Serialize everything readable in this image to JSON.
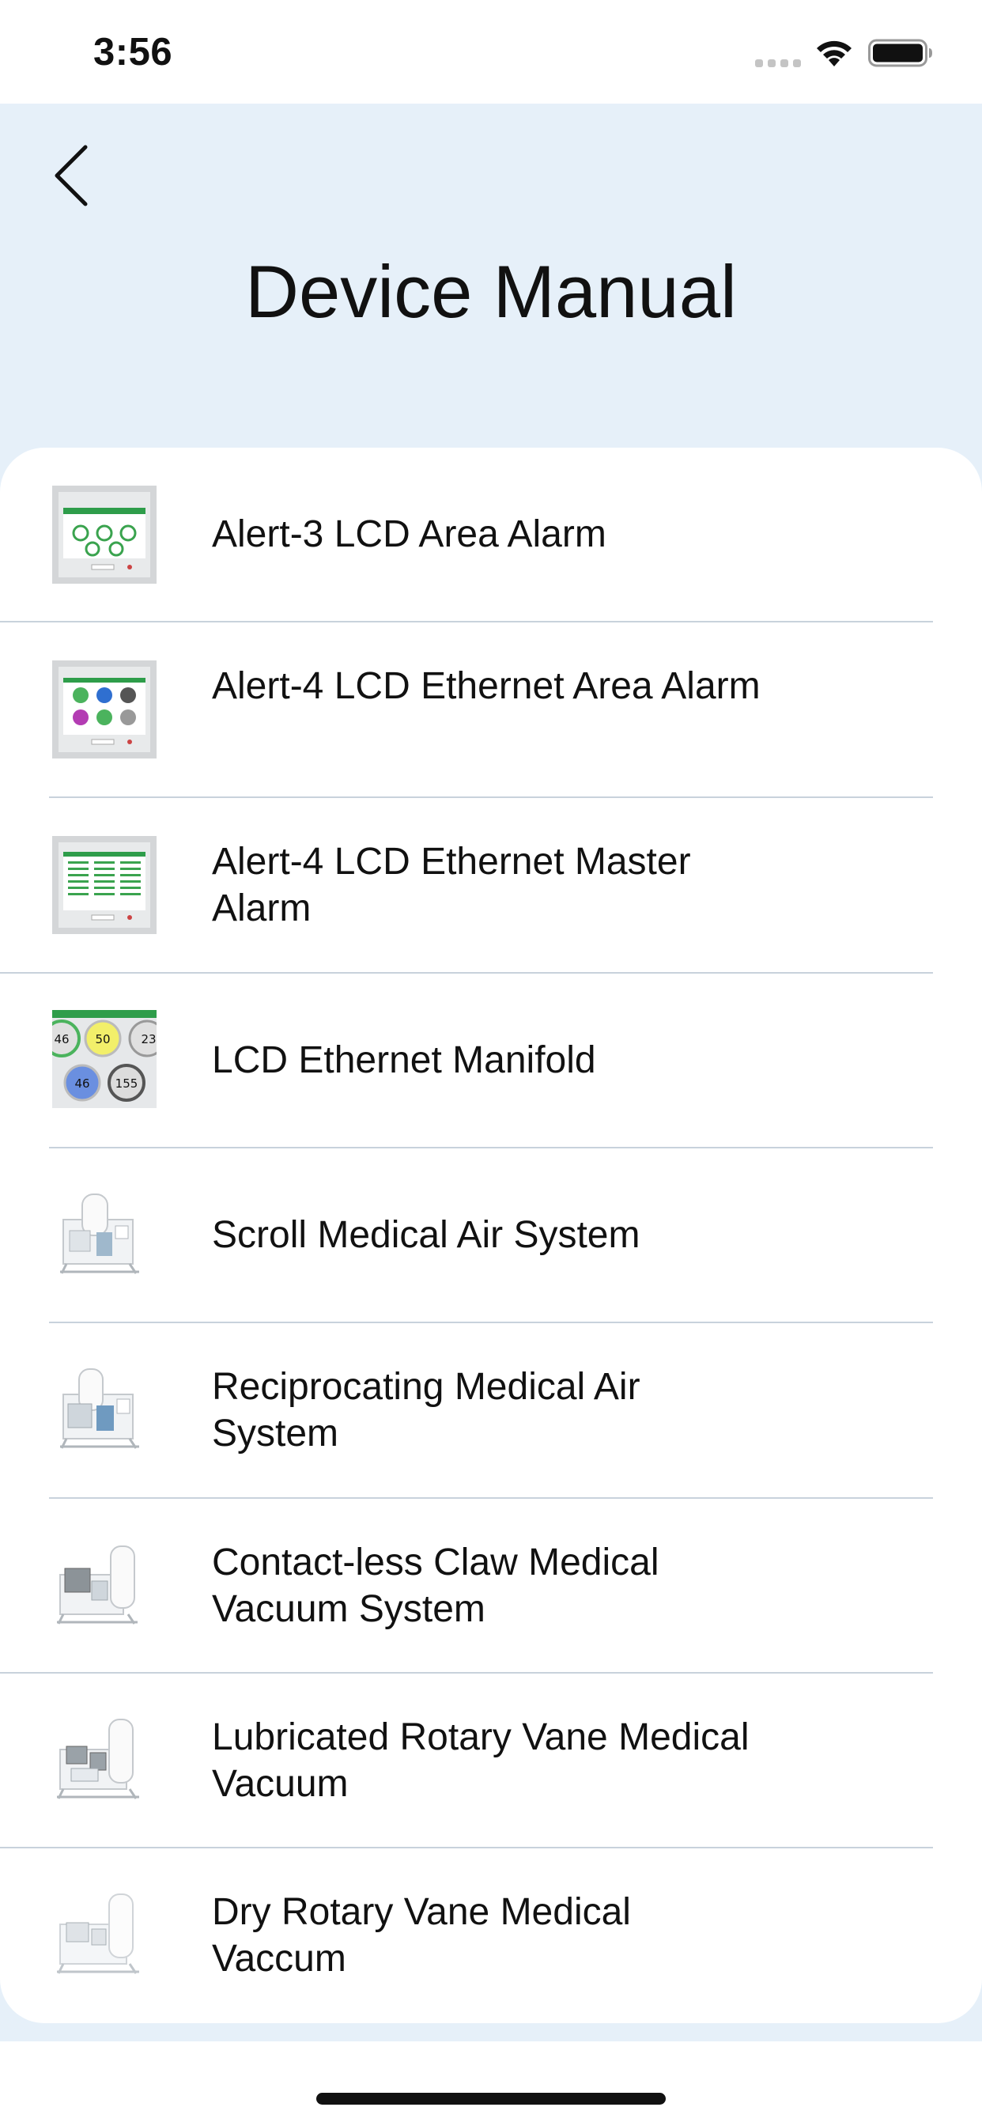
{
  "status_bar": {
    "time": "3:56"
  },
  "header": {
    "title": "Device Manual",
    "back_icon": "chevron-left-icon"
  },
  "items": [
    {
      "label": "Alert-3 LCD Area Alarm",
      "icon": "alarm-panel-thumbnail"
    },
    {
      "label": "Alert-4 LCD Ethernet Area Alarm",
      "icon": "alarm-panel-thumbnail"
    },
    {
      "label": "Alert-4 LCD Ethernet Master Alarm",
      "icon": "alarm-panel-thumbnail"
    },
    {
      "label": "LCD Ethernet Manifold",
      "icon": "manifold-thumbnail"
    },
    {
      "label": "Scroll Medical Air System",
      "icon": "air-system-thumbnail"
    },
    {
      "label": "Reciprocating Medical Air System",
      "icon": "air-system-thumbnail"
    },
    {
      "label": "Contact-less Claw Medical Vacuum System",
      "icon": "vacuum-system-thumbnail"
    },
    {
      "label": "Lubricated Rotary Vane Medical Vacuum",
      "icon": "vacuum-system-thumbnail"
    },
    {
      "label": "Dry Rotary Vane Medical Vaccum",
      "icon": "vacuum-system-thumbnail"
    }
  ],
  "manifold_values": [
    "46",
    "50",
    "23",
    "46",
    "155"
  ],
  "colors": {
    "header_bg": "#e6f0f9",
    "card_bg": "#ffffff",
    "divider": "#c8d2dc",
    "text": "#111111"
  }
}
